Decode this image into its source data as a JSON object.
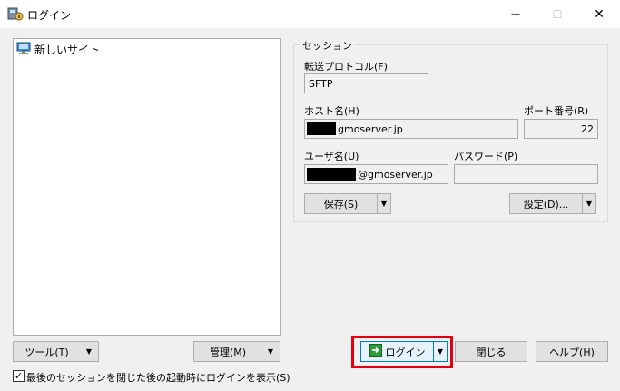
{
  "window": {
    "title": "ログイン",
    "minimize": "—",
    "maximize": "☐",
    "close": "✕"
  },
  "sites": [
    {
      "label": "新しいサイト",
      "icon": "computer-icon"
    }
  ],
  "session": {
    "group_label": "セッション",
    "protocol_label": "転送プロトコル(F)",
    "protocol_value": "SFTP",
    "host_label": "ホスト名(H)",
    "host_value": "gmoserver.jp",
    "port_label": "ポート番号(R)",
    "port_value": "22",
    "user_label": "ユーザ名(U)",
    "user_value": "@gmoserver.jp",
    "password_label": "パスワード(P)",
    "password_value": "",
    "save_label": "保存(S)",
    "settings_label": "設定(D)..."
  },
  "bottom": {
    "tools_label": "ツール(T)",
    "manage_label": "管理(M)",
    "login_label": "ログイン",
    "close_label": "閉じる",
    "help_label": "ヘルプ(H)",
    "show_login_label": "最後のセッションを閉じた後の起動時にログインを表示(S)",
    "show_login_checked": "✓"
  },
  "colors": {
    "highlight": "#e00010",
    "login_border": "#0078d7",
    "login_icon": "#2e9a3a"
  }
}
